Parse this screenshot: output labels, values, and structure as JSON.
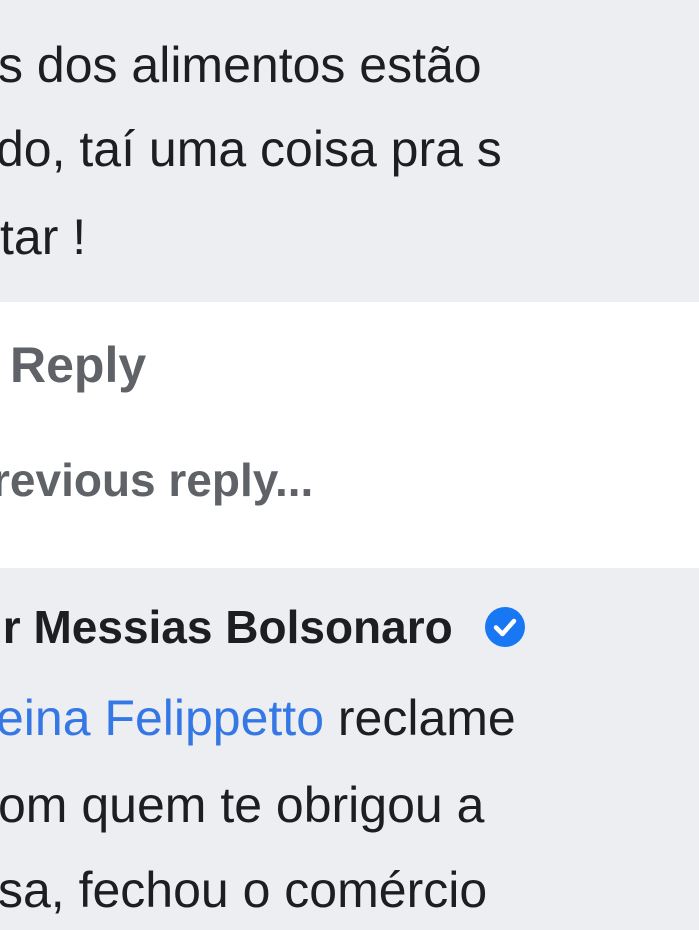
{
  "top_comment": {
    "lines": [
      "s dos alimentos estão",
      "do, taí uma coisa pra s",
      "tar !"
    ]
  },
  "actions": {
    "reply_label": "Reply",
    "previous_reply_label": "revious reply..."
  },
  "reply_comment": {
    "author": "ir Messias Bolsonaro",
    "mention": "eina Felippetto",
    "line1_rest": " reclame",
    "line2": "om quem te obrigou a",
    "line3": "sa, fechou o comércio"
  },
  "colors": {
    "bubble_bg": "#eceef1",
    "link_blue": "#3578e5",
    "action_gray": "#5f6368",
    "verified_badge": "#1877f2"
  },
  "icons": {
    "verified": "verified-badge-icon"
  }
}
